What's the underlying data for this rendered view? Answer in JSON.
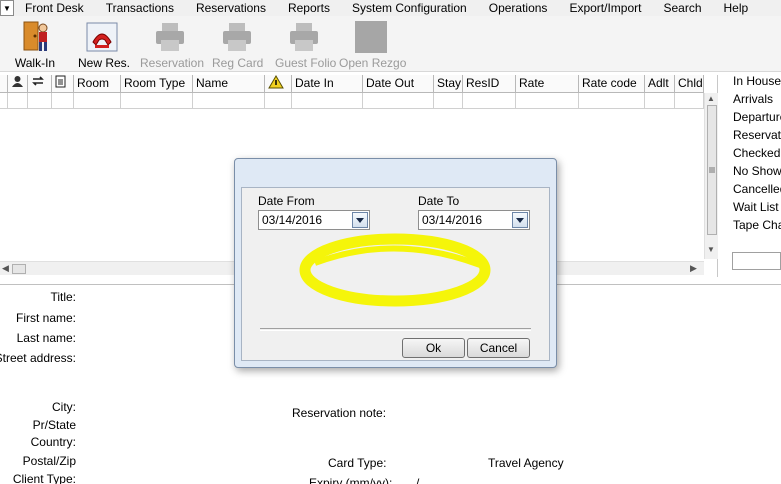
{
  "menu": {
    "items": [
      {
        "label": "Front Desk"
      },
      {
        "label": "Transactions"
      },
      {
        "label": "Reservations"
      },
      {
        "label": "Reports"
      },
      {
        "label": "System Configuration"
      },
      {
        "label": "Operations"
      },
      {
        "label": "Export/Import"
      },
      {
        "label": "Search"
      },
      {
        "label": "Help"
      }
    ]
  },
  "toolbar": {
    "walkin_label": "Walk-In",
    "newres_label": "New Res.",
    "reservation_label": "Reservation",
    "regcard_label": "Reg Card",
    "guestfolio_label": "Guest Folio",
    "openrezgo_label": "Open Rezgo"
  },
  "grid": {
    "columns": [
      "Room",
      "Room Type",
      "Name",
      "Date In",
      "Date Out",
      "Stay",
      "ResID",
      "Rate",
      "Rate code",
      "Adlt",
      "Chld"
    ]
  },
  "side_list": {
    "items": [
      "In House",
      "Arrivals",
      "Departure",
      "Reservatio",
      "Checked O",
      "No Shows",
      "Cancelled",
      "Wait List",
      "Tape Cha"
    ]
  },
  "form": {
    "title_label": "Title:",
    "first_name_label": "First name:",
    "last_name_label": "Last name:",
    "street_label": "Street address:",
    "city_label": "City:",
    "state_label": "Pr/State",
    "country_label": "Country:",
    "postal_label": "Postal/Zip",
    "client_type_label": "Client Type:",
    "res_note_label": "Reservation note:",
    "card_type_label": "Card Type:",
    "expiry_label": "Expiry (mm/yy):",
    "expiry_sep": "/",
    "travel_agency_label": "Travel Agency"
  },
  "dialog": {
    "date_from_label": "Date From",
    "date_from_value": "03/14/2016",
    "date_to_label": "Date To",
    "date_to_value": "03/14/2016",
    "ok_label": "Ok",
    "cancel_label": "Cancel"
  },
  "colors": {
    "highlight": "#f5f50a",
    "dialog_frame": "#dfe9f5",
    "dropdown_accent": "#6d86a8"
  }
}
